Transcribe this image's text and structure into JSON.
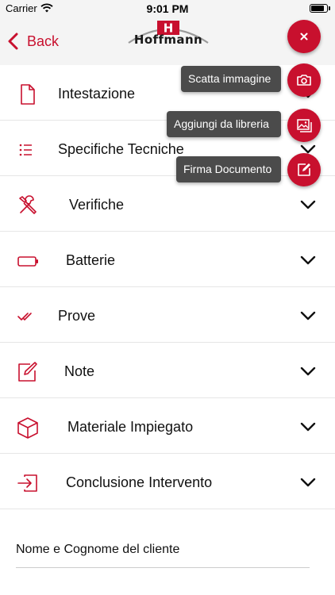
{
  "status": {
    "carrier": "Carrier",
    "time": "9:01 PM",
    "battery_level": 0.85
  },
  "nav": {
    "back_label": "Back",
    "logo_text": "Hoffmann",
    "logo_letter": "H"
  },
  "sections": [
    {
      "label": "Intestazione",
      "icon": "document-icon"
    },
    {
      "label": "Specifiche Tecniche",
      "icon": "list-icon"
    },
    {
      "label": "Verifiche",
      "icon": "tools-icon"
    },
    {
      "label": "Batterie",
      "icon": "battery-icon"
    },
    {
      "label": "Prove",
      "icon": "double-check-icon"
    },
    {
      "label": "Note",
      "icon": "edit-icon"
    },
    {
      "label": "Materiale Impiegato",
      "icon": "box-icon"
    },
    {
      "label": "Conclusione Intervento",
      "icon": "sign-in-icon"
    }
  ],
  "customer_field": {
    "label": "Nome e Cognome del cliente"
  },
  "fab_menu": {
    "main_icon": "close-icon",
    "actions": [
      {
        "label": "Scatta immagine",
        "icon": "camera-icon"
      },
      {
        "label": "Aggiungi da libreria",
        "icon": "image-library-icon"
      },
      {
        "label": "Firma Documento",
        "icon": "sign-icon"
      }
    ]
  },
  "colors": {
    "accent": "#c8102e",
    "bar_background": "#f4f4f4",
    "tooltip_background": "#4b4b4b",
    "divider": "#e6e6e6"
  }
}
